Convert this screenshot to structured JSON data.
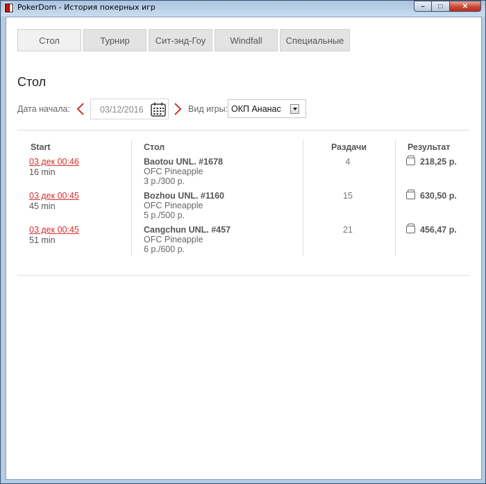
{
  "window": {
    "title": "PokerDom - История покерных игр",
    "minimize": "–",
    "maximize": "□",
    "close": "✕"
  },
  "tabs": [
    {
      "label": "Стол",
      "active": true
    },
    {
      "label": "Турнир",
      "active": false
    },
    {
      "label": "Сит-энд-Гоу",
      "active": false
    },
    {
      "label": "Windfall",
      "active": false
    },
    {
      "label": "Специальные",
      "active": false
    }
  ],
  "section_title": "Стол",
  "filter": {
    "date_label": "Дата начала:",
    "date_value": "03/12/2016",
    "game_type_label": "Вид игры:",
    "game_type_value": "ОКП Ананас"
  },
  "columns": {
    "start": "Start",
    "table": "Стол",
    "hands": "Раздачи",
    "result": "Результат"
  },
  "rows": [
    {
      "start": "03 дек 00:46",
      "duration": "16 min",
      "table_name": "Baotou UNL. #1678",
      "game": "OFC Pineapple",
      "stakes": "3 р./300 р.",
      "hands": "4",
      "result": "218,25 р."
    },
    {
      "start": "03 дек 00:45",
      "duration": "45 min",
      "table_name": "Bozhou UNL. #1160",
      "game": "OFC Pineapple",
      "stakes": "5 р./500 р.",
      "hands": "15",
      "result": "630,50 р."
    },
    {
      "start": "03 дек 00:45",
      "duration": "51 min",
      "table_name": "Cangchun UNL. #457",
      "game": "OFC Pineapple",
      "stakes": "6 р./600 р.",
      "hands": "21",
      "result": "456,47 р."
    }
  ],
  "colors": {
    "accent": "#d03030",
    "tab_bg": "#e3e3e3",
    "text": "#555555"
  }
}
